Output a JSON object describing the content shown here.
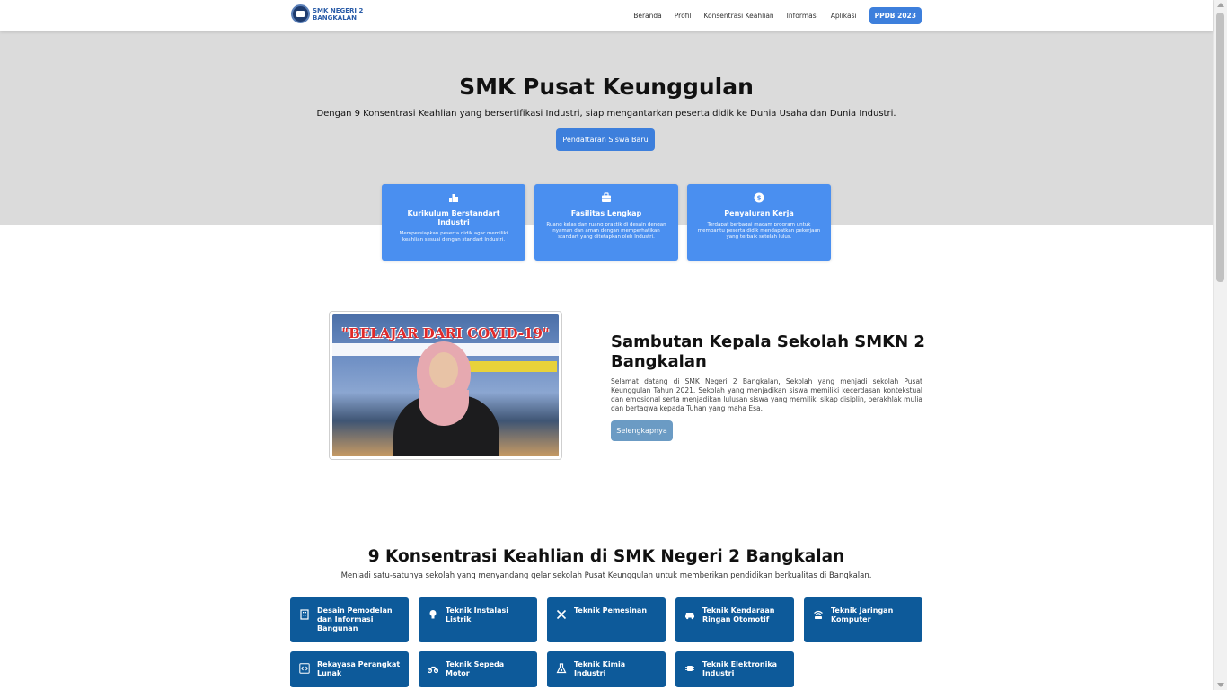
{
  "navbar": {
    "brand_line1": "SMK NEGERI 2",
    "brand_line2": "BANGKALAN",
    "links": [
      "Beranda",
      "Profil",
      "Konsentrasi Keahlian",
      "Informasi",
      "Aplikasi"
    ],
    "cta": "PPDB 2023"
  },
  "hero": {
    "title": "SMK Pusat Keunggulan",
    "subtitle": "Dengan 9 Konsentrasi Keahlian yang bersertifikasi Industri, siap mengantarkan peserta didik ke Dunia Usaha dan Dunia Industri.",
    "button": "Pendaftaran SIswa Baru"
  },
  "features": [
    {
      "icon": "chart-icon",
      "title": "Kurikulum Berstandart Industri",
      "desc": "Mempersiapkan peserta didik agar memiliki keahlian sesuai dengan standart Industri."
    },
    {
      "icon": "briefcase-icon",
      "title": "Fasilitas Lengkap",
      "desc": "Ruang kelas dan ruang praktik di desain dengan nyaman dan aman dengan memperhatikan standart yang ditetapkan oleh Industri."
    },
    {
      "icon": "coin-icon",
      "title": "Penyaluran Kerja",
      "desc": "Terdapat berbagai macam program untuk membantu peserta didik mendapatkan pekerjaan yang terbaik setelah lulus."
    }
  ],
  "principal": {
    "photo_banner": "\"BELAJAR DARI COVID-19\"",
    "title": "Sambutan Kepala Sekolah SMKN 2 Bangkalan",
    "text": "Selamat datang di SMK Negeri 2 Bangkalan, Sekolah yang menjadi sekolah Pusat Keunggulan Tahun 2021. Sekolah yang menjadikan siswa memiliki kecerdasan kontekstual dan emosional serta menjadikan lulusan siswa yang memiliki sikap disiplin, berakhlak mulia dan bertaqwa kepada Tuhan yang maha Esa.",
    "button": "Selengkapnya"
  },
  "programs": {
    "title": "9 Konsentrasi Keahlian di SMK Negeri 2 Bangkalan",
    "subtitle": "Menjadi satu-satunya sekolah yang menyandang gelar sekolah Pusat Keunggulan untuk memberikan pendidikan berkualitas di Bangkalan.",
    "items": [
      {
        "icon": "building-icon",
        "label": "Desain Pemodelan dan Informasi Bangunan"
      },
      {
        "icon": "lightbulb-icon",
        "label": "Teknik Instalasi Listrik"
      },
      {
        "icon": "tools-icon",
        "label": "Teknik Pemesinan"
      },
      {
        "icon": "car-icon",
        "label": "Teknik Kendaraan Ringan Otomotif"
      },
      {
        "icon": "wifi-router-icon",
        "label": "Teknik Jaringan Komputer"
      },
      {
        "icon": "code-icon",
        "label": "Rekayasa Perangkat Lunak"
      },
      {
        "icon": "motorcycle-icon",
        "label": "Teknik Sepeda Motor"
      },
      {
        "icon": "flask-icon",
        "label": "Teknik Kimia Industri"
      },
      {
        "icon": "chip-icon",
        "label": "Teknik Elektronika Industri"
      }
    ]
  }
}
